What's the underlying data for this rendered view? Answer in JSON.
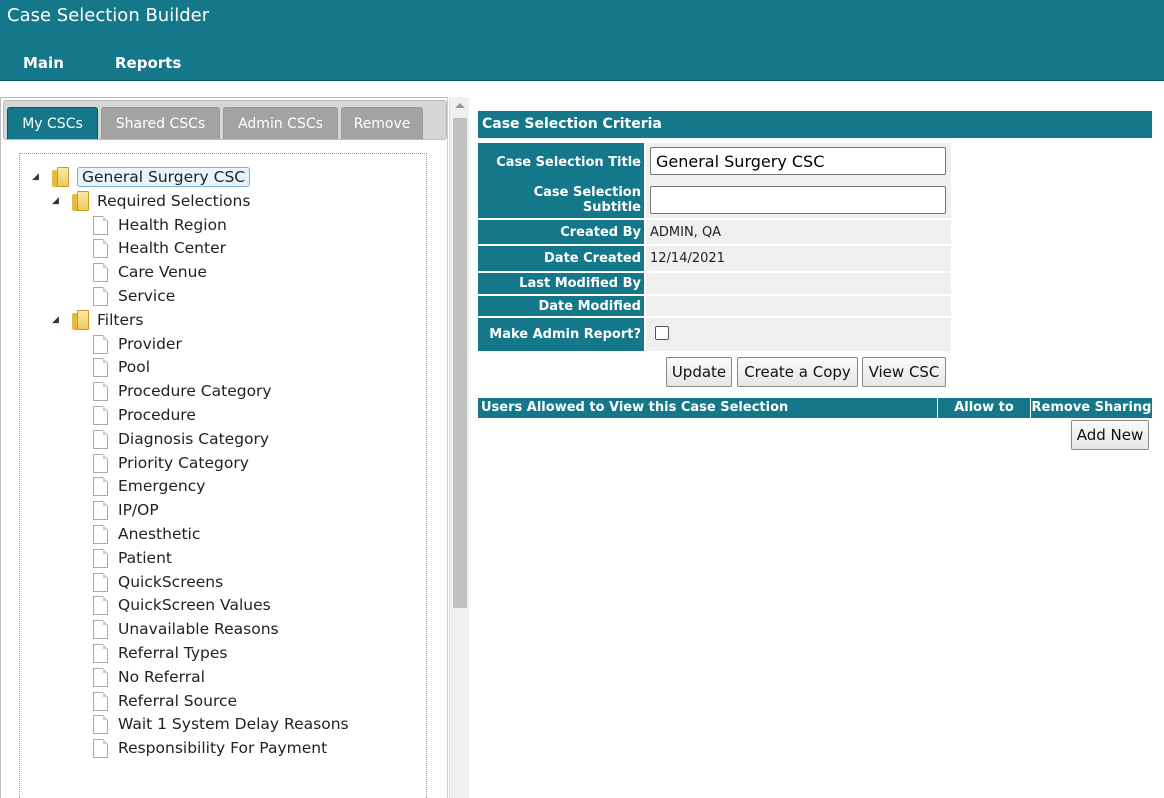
{
  "app": {
    "title": "Case Selection Builder"
  },
  "nav": {
    "main": "Main",
    "reports": "Reports"
  },
  "tabs": [
    {
      "label": "My CSCs",
      "active": true
    },
    {
      "label": "Shared CSCs",
      "active": false
    },
    {
      "label": "Admin CSCs",
      "active": false
    },
    {
      "label": "Remove",
      "active": false
    }
  ],
  "tree": {
    "root": "General Surgery CSC",
    "required_label": "Required Selections",
    "required_items": [
      "Health Region",
      "Health Center",
      "Care Venue",
      "Service"
    ],
    "filters_label": "Filters",
    "filter_items": [
      "Provider",
      "Pool",
      "Procedure Category",
      "Procedure",
      "Diagnosis Category",
      "Priority Category",
      "Emergency",
      "IP/OP",
      "Anesthetic",
      "Patient",
      "QuickScreens",
      "QuickScreen Values",
      "Unavailable Reasons",
      "Referral Types",
      "No Referral",
      "Referral Source",
      "Wait 1 System Delay Reasons",
      "Responsibility For Payment"
    ]
  },
  "criteria": {
    "header": "Case Selection Criteria",
    "title_label": "Case Selection Title",
    "title_value": "General Surgery CSC",
    "subtitle_label": "Case Selection Subtitle",
    "subtitle_value": "",
    "created_by_label": "Created By",
    "created_by_value": "ADMIN, QA",
    "date_created_label": "Date Created",
    "date_created_value": "12/14/2021",
    "last_modified_by_label": "Last Modified By",
    "last_modified_by_value": "",
    "date_modified_label": "Date Modified",
    "date_modified_value": "",
    "admin_report_label": "Make Admin Report?",
    "admin_report_checked": false
  },
  "buttons": {
    "update": "Update",
    "copy": "Create a Copy",
    "view": "View CSC",
    "add_new": "Add New"
  },
  "users_table": {
    "col_users": "Users Allowed to View this Case Selection",
    "col_edit": "Allow to Edit",
    "col_remove": "Remove Sharing"
  },
  "colors": {
    "accent": "#15788a",
    "tab_inactive": "#a3a3a3"
  }
}
